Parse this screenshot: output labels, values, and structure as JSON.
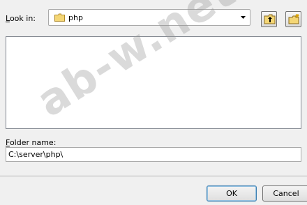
{
  "look_in": {
    "label_first": "L",
    "label_rest": "ook in:",
    "value": "php",
    "icon": "folder-icon"
  },
  "toolbar": {
    "up_icon": "up-folder-icon",
    "new_icon": "new-folder-icon"
  },
  "folder_list": {
    "items": []
  },
  "folder_name": {
    "label_first": "F",
    "label_rest": "older name:",
    "value": "C:\\server\\php\\"
  },
  "buttons": {
    "ok": "OK",
    "cancel": "Cancel"
  },
  "watermark": "ab-w.net",
  "colors": {
    "accent": "#3c7fb1",
    "folder": "#f4d675"
  }
}
